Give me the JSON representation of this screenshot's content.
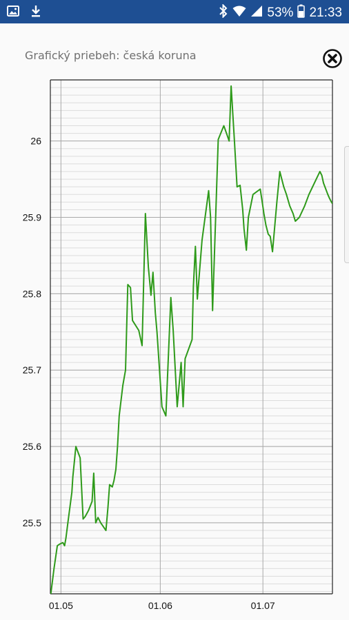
{
  "status_bar": {
    "left_icons": [
      "image-icon",
      "download-icon"
    ],
    "right_icons": [
      "bluetooth-icon",
      "wifi-icon",
      "signal-icon",
      "battery-icon"
    ],
    "battery": "53%",
    "time": "21:33"
  },
  "dialog": {
    "title": "Grafický priebeh: česká koruna",
    "close_icon": "close-circle-icon"
  },
  "colors": {
    "status_bar": "#1e4f93",
    "line": "#2e9a1a",
    "grid_minor": "#dcdcdc",
    "grid_major": "#a8a8a8"
  },
  "chart_data": {
    "type": "line",
    "grid": true,
    "legend": "none",
    "ylim": [
      25.407,
      26.08
    ],
    "yticks": [
      25.5,
      25.6,
      25.7,
      25.8,
      25.9,
      26
    ],
    "ytick_labels": [
      "25.5",
      "25.6",
      "25.7",
      "25.8",
      "25.9",
      "26"
    ],
    "xlim": [
      -3.2,
      82.0
    ],
    "xticks": [
      0,
      30,
      61
    ],
    "xtick_labels": [
      "01.05",
      "01.06",
      "01.07"
    ],
    "series": [
      {
        "x": [
          -3.2,
          -2.1,
          -1.1,
          -0.4,
          0.6,
          1.1,
          1.5,
          2.1,
          3.3,
          3.6,
          4.5,
          5.8,
          6.7,
          7.3,
          7.8,
          8.3,
          9.4,
          9.9,
          10.5,
          11.2,
          12.0,
          13.6,
          14.2,
          14.7,
          15.5,
          16.0,
          16.6,
          17.1,
          17.6,
          18.7,
          19.5,
          20.2,
          21.0,
          21.6,
          23.5,
          24.5,
          25.5,
          26.4,
          27.2,
          27.8,
          28.5,
          29.0,
          30.5,
          31.7,
          33.2,
          33.9,
          35.1,
          36.3,
          36.9,
          37.5,
          39.6,
          40.0,
          40.6,
          41.2,
          42.6,
          44.6,
          45.2,
          45.8,
          47.5,
          49.2,
          50.0,
          50.8,
          51.4,
          52.4,
          53.2,
          54.1,
          54.9,
          55.3,
          56.0,
          56.6,
          58.0,
          60.2,
          60.8,
          61.3,
          61.9,
          62.6,
          63.2,
          63.9,
          65.2,
          66.1,
          67.3,
          68.1,
          69.1,
          70.1,
          70.8,
          72.0,
          73.6,
          74.9,
          77.1,
          78.2,
          78.8,
          79.3,
          80.6,
          81.1,
          81.7,
          82.0
        ],
        "y": [
          25.402,
          25.44,
          25.47,
          25.472,
          25.474,
          25.47,
          25.48,
          25.5,
          25.54,
          25.56,
          25.6,
          25.585,
          25.505,
          25.508,
          25.512,
          25.516,
          25.528,
          25.565,
          25.5,
          25.507,
          25.5,
          25.49,
          25.52,
          25.55,
          25.547,
          25.555,
          25.57,
          25.6,
          25.64,
          25.68,
          25.7,
          25.812,
          25.808,
          25.765,
          25.752,
          25.732,
          25.905,
          25.835,
          25.798,
          25.828,
          25.775,
          25.75,
          25.652,
          25.64,
          25.795,
          25.752,
          25.652,
          25.71,
          25.652,
          25.715,
          25.74,
          25.81,
          25.862,
          25.793,
          25.87,
          25.935,
          25.9,
          25.778,
          26.002,
          26.02,
          26.01,
          26.0,
          26.072,
          26.0,
          25.94,
          25.942,
          25.91,
          25.885,
          25.857,
          25.9,
          25.93,
          25.937,
          25.92,
          25.905,
          25.89,
          25.878,
          25.875,
          25.855,
          25.92,
          25.96,
          25.94,
          25.93,
          25.915,
          25.905,
          25.895,
          25.9,
          25.915,
          25.93,
          25.95,
          25.96,
          25.955,
          25.945,
          25.93,
          25.925,
          25.92,
          25.918
        ]
      }
    ]
  }
}
